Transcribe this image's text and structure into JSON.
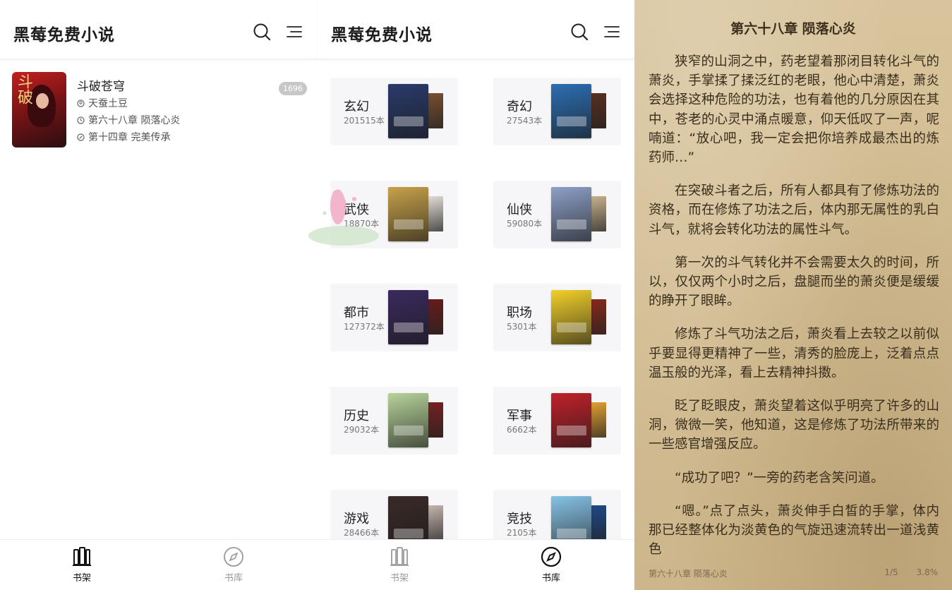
{
  "app_title": "黑莓免费小说",
  "colors": {
    "accent": "#111111",
    "inactive": "#9a9a9a",
    "badge": "#c7c7c7",
    "reader_bg": "#d5c097",
    "card_bg": "#f6f6f8"
  },
  "icons": {
    "search": "search-icon",
    "menu": "menu-lines-icon",
    "shelf": "bookshelf-icon",
    "library": "compass-icon"
  },
  "shelf": {
    "book": {
      "title": "斗破苍穹",
      "author": "天蚕土豆",
      "last_read": "第六十八章 陨落心炎",
      "latest": "第十四章 完美传承",
      "unread_count": "1696"
    }
  },
  "nav": {
    "shelf_label": "书架",
    "library_label": "书库"
  },
  "categories": [
    {
      "name": "玄幻",
      "count": "201515本",
      "c1": "#2a3b6b",
      "c2": "#7a5030"
    },
    {
      "name": "奇幻",
      "count": "27543本",
      "c1": "#2d6fb3",
      "c2": "#5a3020"
    },
    {
      "name": "武侠",
      "count": "18870本",
      "c1": "#c8a24a",
      "c2": "#e6e0d8"
    },
    {
      "name": "仙侠",
      "count": "59080本",
      "c1": "#8ea0c8",
      "c2": "#cbb590"
    },
    {
      "name": "都市",
      "count": "127372本",
      "c1": "#3b2a5e",
      "c2": "#6a1c1a"
    },
    {
      "name": "职场",
      "count": "5301本",
      "c1": "#f2d02a",
      "c2": "#8a2a1a"
    },
    {
      "name": "历史",
      "count": "29032本",
      "c1": "#b7d39a",
      "c2": "#7a2020"
    },
    {
      "name": "军事",
      "count": "6662本",
      "c1": "#c0212a",
      "c2": "#e7a232"
    },
    {
      "name": "游戏",
      "count": "28466本",
      "c1": "#3a2a28",
      "c2": "#c8b8b0"
    },
    {
      "name": "竞技",
      "count": "2105本",
      "c1": "#86c3e6",
      "c2": "#1f4a8a"
    }
  ],
  "reader": {
    "chapter_title": "第六十八章 陨落心炎",
    "paragraphs": [
      "狭窄的山洞之中，药老望着那闭目转化斗气的萧炎，手掌揉了揉泛红的老眼，他心中清楚，萧炎会选择这种危险的功法，也有着他的几分原因在其中，苍老的心灵中涌点暖意，仰天低叹了一声，呢喃道：“放心吧，我一定会把你培养成最杰出的炼药师…”",
      "在突破斗者之后，所有人都具有了修炼功法的资格，而在修炼了功法之后，体内那无属性的乳白斗气，就将会转化功法的属性斗气。",
      "第一次的斗气转化并不会需要太久的时间，所以，仅仅两个小时之后，盘腿而坐的萧炎便是缓缓的睁开了眼眸。",
      "修炼了斗气功法之后，萧炎看上去较之以前似乎要显得更精神了一些，清秀的脸庞上，泛着点点温玉般的光泽，看上去精神抖擞。",
      "眨了眨眼皮，萧炎望着这似乎明亮了许多的山洞，微微一笑，他知道，这是修炼了功法所带来的一些感官增强反应。",
      "“成功了吧？”一旁的药老含笑问道。",
      "“嗯。”点了点头，萧炎伸手白皙的手掌，体内那已经整体化为淡黄色的气旋迅速流转出一道浅黄色"
    ],
    "footer_chapter": "第六十八章 陨落心炎",
    "page": "1/5",
    "progress": "3.8%"
  }
}
